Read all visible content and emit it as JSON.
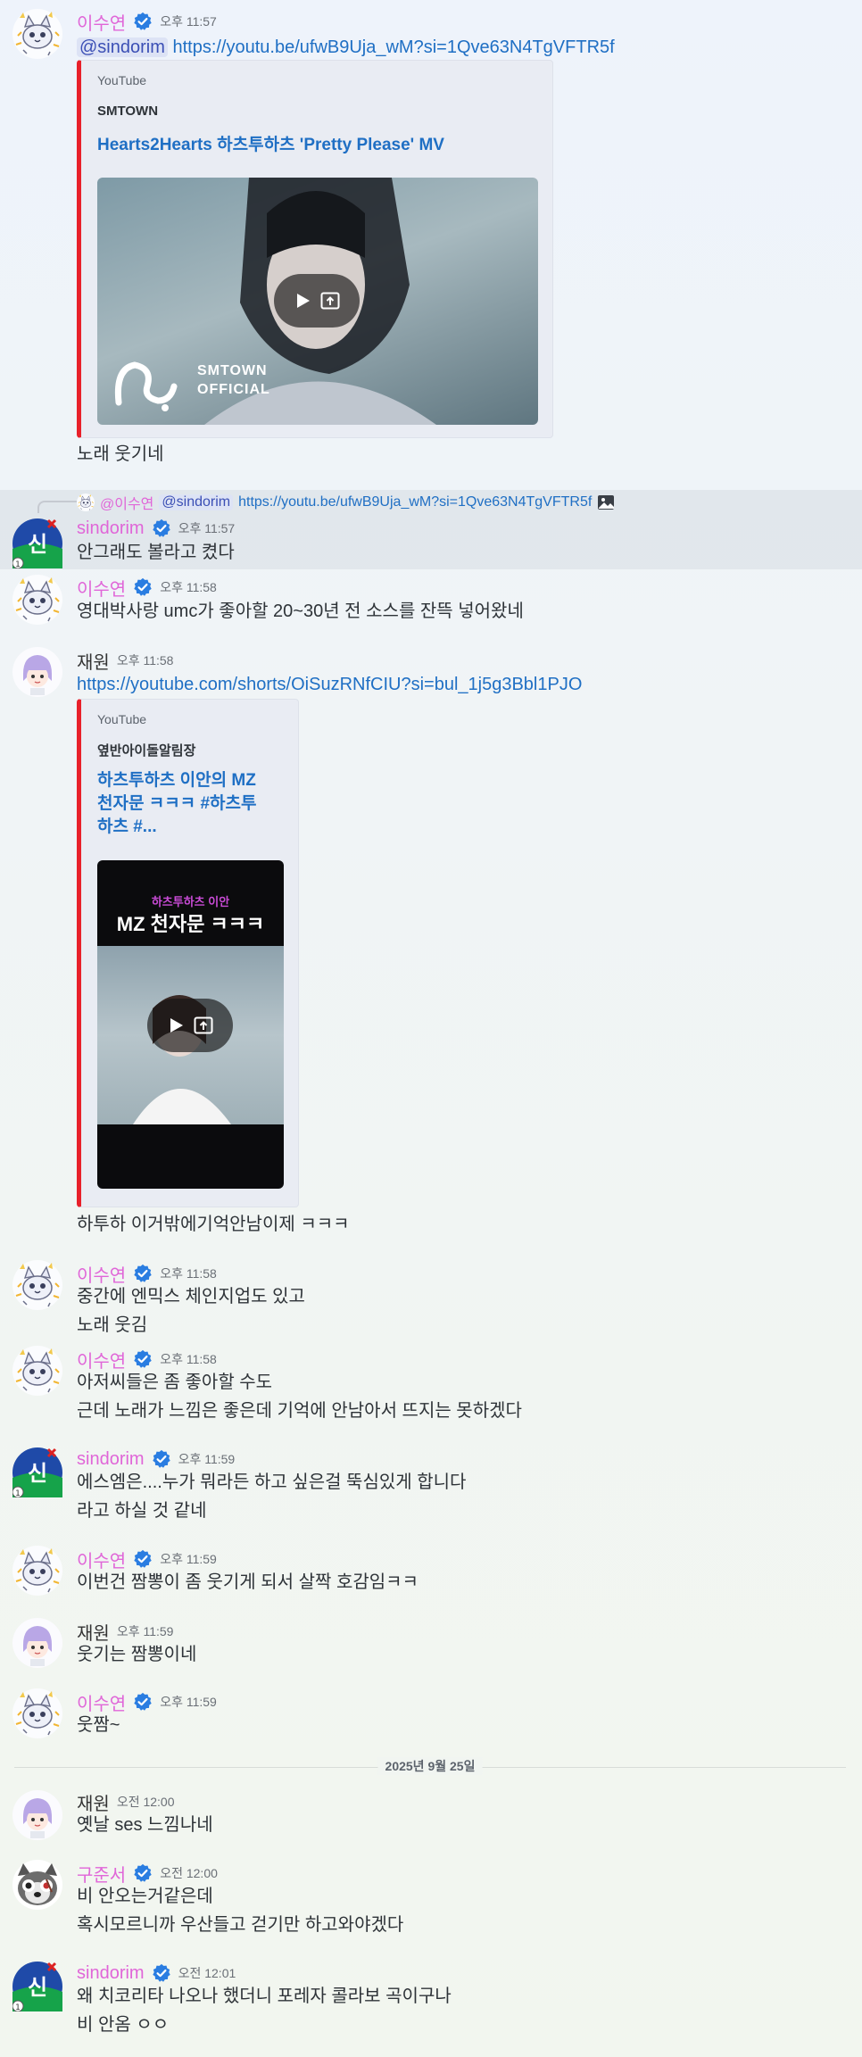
{
  "colors": {
    "name_pink": "#e066d8",
    "link": "#1f6fc4",
    "embed_bar": "#e8202a",
    "verified": "#2a7de1"
  },
  "messages": {
    "m1": {
      "author": "이수연",
      "time": "오후 11:57",
      "mention": "@sindorim",
      "link": "https://youtu.be/ufwB9Uja_wM?si=1Qve63N4TgVFTR5f",
      "embed": {
        "provider": "YouTube",
        "author": "SMTOWN",
        "title": "Hearts2Hearts 하츠투하츠 'Pretty Please' MV",
        "logo_text_1": "SMTOWN",
        "logo_text_2": "OFFICIAL"
      },
      "text": "노래 웃기네"
    },
    "m2": {
      "reply_author": "@이수연",
      "reply_mention": "@sindorim",
      "reply_link": "https://youtu.be/ufwB9Uja_wM?si=1Qve63N4TgVFTR5f",
      "author": "sindorim",
      "time": "오후 11:57",
      "text": "안그래도 볼라고 켰다"
    },
    "m3": {
      "author": "이수연",
      "time": "오후 11:58",
      "text": "영대박사랑 umc가 좋아할 20~30년 전 소스를 잔뜩 넣어왔네"
    },
    "m4": {
      "author": "재원",
      "time": "오후 11:58",
      "link": "https://youtube.com/shorts/OiSuzRNfCIU?si=bul_1j5g3Bbl1PJO",
      "embed": {
        "provider": "YouTube",
        "author": "옆반아이돌알림장",
        "title_1": "하츠투하츠 이안의 MZ",
        "title_2": "천자문 ㅋㅋㅋ #하츠투",
        "title_3": "하츠 #...",
        "thumb_text_1": "하츠투하츠 이안",
        "thumb_text_2": "MZ 천자문 ㅋㅋㅋ"
      },
      "text": "하투하 이거밖에기억안남이제 ㅋㅋㅋ"
    },
    "m5": {
      "author": "이수연",
      "time": "오후 11:58",
      "text_1": "중간에 엔믹스 체인지업도 있고",
      "text_2": "노래 웃김"
    },
    "m6": {
      "author": "이수연",
      "time": "오후 11:58",
      "text_1": "아저씨들은 좀 좋아할 수도",
      "text_2": "근데 노래가 느낌은 좋은데 기억에 안남아서 뜨지는 못하겠다"
    },
    "m7": {
      "author": "sindorim",
      "time": "오후 11:59",
      "text_1": "에스엠은....누가 뭐라든 하고 싶은걸 뚝심있게 합니다",
      "text_2": "라고 하실 것 같네"
    },
    "m8": {
      "author": "이수연",
      "time": "오후 11:59",
      "text": "이번건 짬뽕이 좀 웃기게 되서 살짝 호감임ㅋㅋ"
    },
    "m9": {
      "author": "재원",
      "time": "오후 11:59",
      "text": "웃기는 짬뽕이네"
    },
    "m10": {
      "author": "이수연",
      "time": "오후 11:59",
      "text": "웃짬~"
    },
    "date_divider": "2025년 9월 25일",
    "m11": {
      "author": "재원",
      "time": "오전 12:00",
      "text": "옛날 ses 느낌나네"
    },
    "m12": {
      "author": "구준서",
      "time": "오전 12:00",
      "text_1": "비 안오는거같은데",
      "text_2": "혹시모르니까 우산들고 걷기만 하고와야겠다"
    },
    "m13": {
      "author": "sindorim",
      "time": "오전 12:01",
      "text_1": "왜 치코리타 나오나 했더니 포레자 콜라보 곡이구나",
      "text_2": "비 안옴 ㅇㅇ"
    }
  },
  "avatar_labels": {
    "sindorim": "신"
  }
}
